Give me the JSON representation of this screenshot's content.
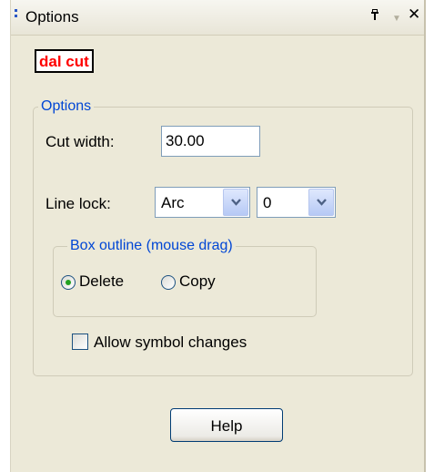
{
  "panel": {
    "title": "Options",
    "tool_name": "dal cut"
  },
  "options_group": {
    "legend": "Options",
    "cut_width_label": "Cut width:",
    "cut_width_value": "30.00",
    "line_lock_label": "Line lock:",
    "line_lock_mode": "Arc",
    "line_lock_value": "0"
  },
  "box_outline": {
    "legend": "Box outline (mouse drag)",
    "options": [
      {
        "label": "Delete",
        "selected": true
      },
      {
        "label": "Copy",
        "selected": false
      }
    ]
  },
  "allow_symbol_changes": {
    "label": "Allow symbol changes",
    "checked": false
  },
  "help_button": "Help",
  "icons": {
    "grip": "drag-grip-icon",
    "pin": "pin-icon",
    "dropdown": "dropdown-arrow-icon",
    "close": "close-icon",
    "combo": "chevron-down-icon"
  },
  "colors": {
    "accent": "#0046d5",
    "tool_name": "#ff0000",
    "panel_bg": "#ece9d8"
  }
}
